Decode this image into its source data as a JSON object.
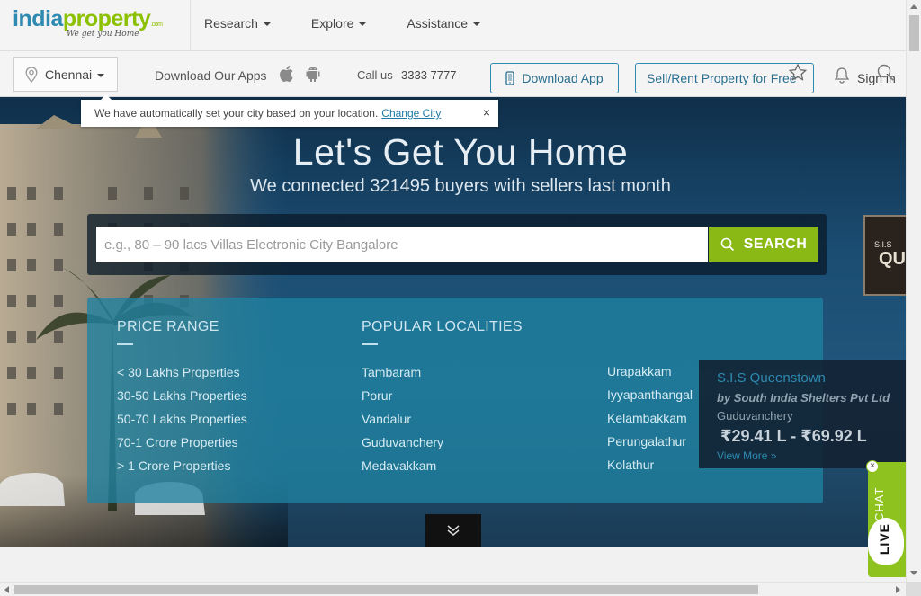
{
  "header": {
    "logo_main_a": "india",
    "logo_main_b": "property",
    "logo_com": ".com",
    "logo_tagline": "We get you Home",
    "nav": [
      {
        "label": "Research"
      },
      {
        "label": "Explore"
      },
      {
        "label": "Assistance"
      }
    ]
  },
  "subbar": {
    "city": "Chennai",
    "apps_label": "Download Our Apps",
    "call_label": "Call us",
    "call_number": "3333 7777",
    "download_app": "Download App",
    "sell_rent": "Sell/Rent Property for Free",
    "sign_in": "Sign in"
  },
  "tooltip": {
    "message": "We have automatically set your city based on your location.",
    "link": "Change City",
    "close": "×"
  },
  "hero": {
    "title": "Let's Get You Home",
    "subtitle": "We connected 321495 buyers with sellers last month"
  },
  "search": {
    "placeholder": "e.g., 80 – 90 lacs Villas Electronic City Bangalore",
    "button": "SEARCH"
  },
  "price_range": {
    "title": "PRICE RANGE",
    "items": [
      "< 30 Lakhs Properties",
      "30-50 Lakhs Properties",
      "50-70 Lakhs Properties",
      "70-1 Crore Properties",
      "> 1 Crore Properties"
    ]
  },
  "localities": {
    "title": "POPULAR LOCALITIES",
    "col1": [
      "Tambaram",
      "Porur",
      "Vandalur",
      "Guduvanchery",
      "Medavakkam"
    ],
    "col2": [
      "Urapakkam",
      "Iyyapanthangal",
      "Kelambakkam",
      "Perungalathur",
      "Kolathur"
    ]
  },
  "promo": {
    "thumb_small": "S.I.S",
    "thumb_big": "QU",
    "name": "S.I.S Queenstown",
    "by": "by South India Shelters Pvt Ltd",
    "location": "Guduvanchery",
    "price": "₹29.41 L - ₹69.92 L",
    "more": "View More  »"
  },
  "chat": {
    "label": "CHAT",
    "live": "LIVE",
    "close": "×"
  },
  "colors": {
    "brand_blue": "#2e8ab0",
    "brand_green": "#8bc100",
    "search_green": "#8ab916"
  }
}
